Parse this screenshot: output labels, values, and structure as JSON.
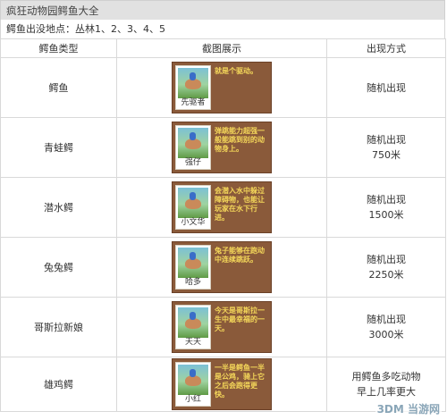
{
  "title": "疯狂动物园鳄鱼大全",
  "location": "鳄鱼出没地点：丛林1、2、3、4、5",
  "headers": {
    "type": "鳄鱼类型",
    "screenshot": "截图展示",
    "method": "出现方式"
  },
  "rows": [
    {
      "type": "鳄鱼",
      "caption": "先驱者",
      "note": "就是个驱动。",
      "method_line1": "随机出现",
      "method_line2": ""
    },
    {
      "type": "青蛙鳄",
      "caption": "强仔",
      "note": "弹跳能力超强一般能跳到别的动物身上。",
      "method_line1": "随机出现",
      "method_line2": "750米"
    },
    {
      "type": "潜水鳄",
      "caption": "小文华",
      "note": "会潜入水中躲过障碍物，也能让玩家在水下行进。",
      "method_line1": "随机出现",
      "method_line2": "1500米"
    },
    {
      "type": "兔兔鳄",
      "caption": "哈多",
      "note": "兔子能够在跑动中连续跳跃。",
      "method_line1": "随机出现",
      "method_line2": "2250米"
    },
    {
      "type": "哥斯拉新娘",
      "caption": "天天",
      "note": "今天是哥斯拉一生中最幸福的一天。",
      "method_line1": "随机出现",
      "method_line2": "3000米"
    },
    {
      "type": "雄鸡鳄",
      "caption": "小红",
      "note": "一半是鳄鱼一半是公鸡，骑上它之后会跑得更快。",
      "method_line1": "用鳄鱼多吃动物",
      "method_line2": "早上几率更大"
    }
  ],
  "watermark": "3DM 当游网",
  "colors": {
    "title_bg": "#e1e1e1",
    "card_bg": "#8a5a3a",
    "note_text": "#f4d75a"
  }
}
